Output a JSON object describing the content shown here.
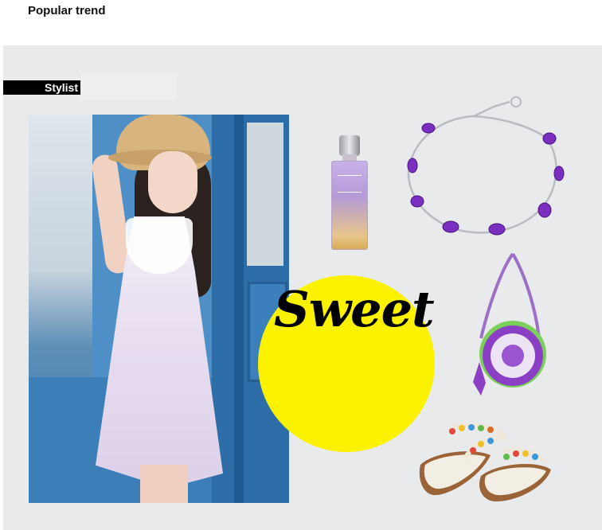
{
  "header": {
    "section_title": "Popular trend"
  },
  "board": {
    "tag_label": "Stylist",
    "headline": "Sweet",
    "background_color": "#e9eaec",
    "accent_color": "#fbf200",
    "products": [
      {
        "name": "perfume-bottle",
        "icon": "perfume-icon"
      },
      {
        "name": "amethyst-bracelet",
        "icon": "bracelet-icon"
      },
      {
        "name": "round-crossbody-bag",
        "icon": "bag-icon"
      },
      {
        "name": "beaded-sandals",
        "icon": "sandals-icon"
      }
    ]
  }
}
